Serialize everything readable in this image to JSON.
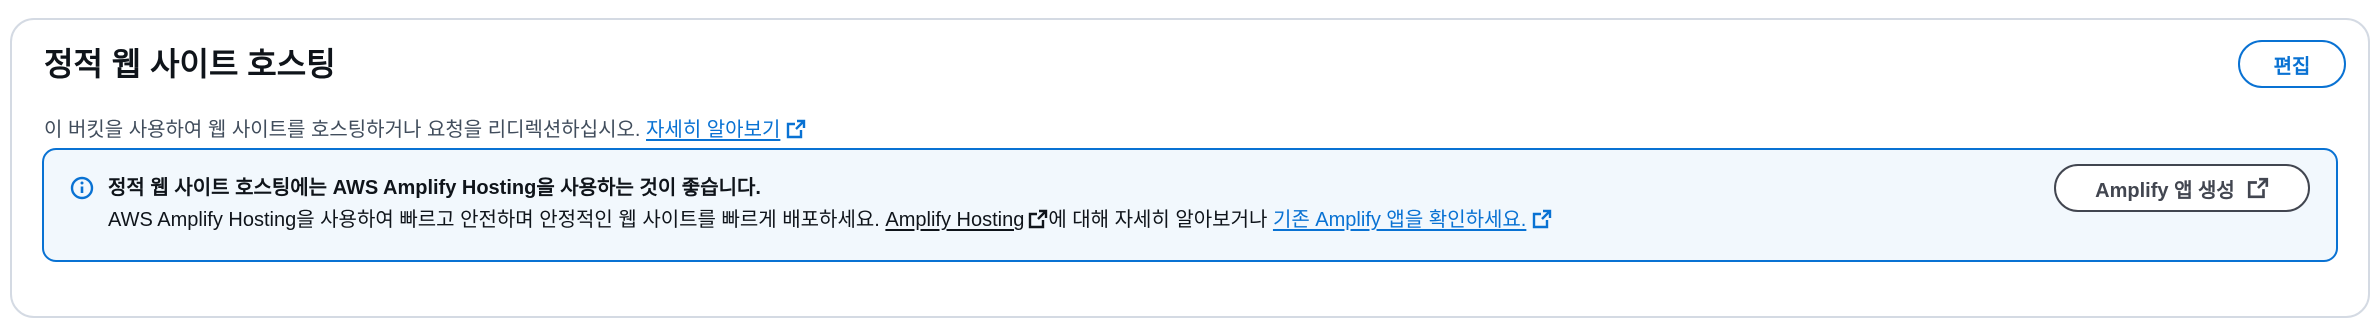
{
  "section": {
    "title": "정적 웹 사이트 호스팅",
    "description": "이 버킷을 사용하여 웹 사이트를 호스팅하거나 요청을 리디렉션하십시오.",
    "learn_more_link": "자세히 알아보기",
    "edit_button": "편집"
  },
  "alert": {
    "icon": "info-icon",
    "title": "정적 웹 사이트 호스팅에는 AWS Amplify Hosting을 사용하는 것이 좋습니다.",
    "body_prefix": "AWS Amplify Hosting을 사용하여 빠르고 안전하며 안정적인 웹 사이트를 빠르게 배포하세요.",
    "amplify_hosting_link": "Amplify Hosting",
    "body_middle": "에 대해 자세히 알아보거나",
    "existing_apps_link": "기존 Amplify 앱을 확인하세요.",
    "create_button": "Amplify 앱 생성"
  },
  "colors": {
    "link": "#0972d3",
    "alert_border": "#0972d3",
    "alert_background": "#f2f8fd",
    "container_border": "#d4dae3"
  }
}
